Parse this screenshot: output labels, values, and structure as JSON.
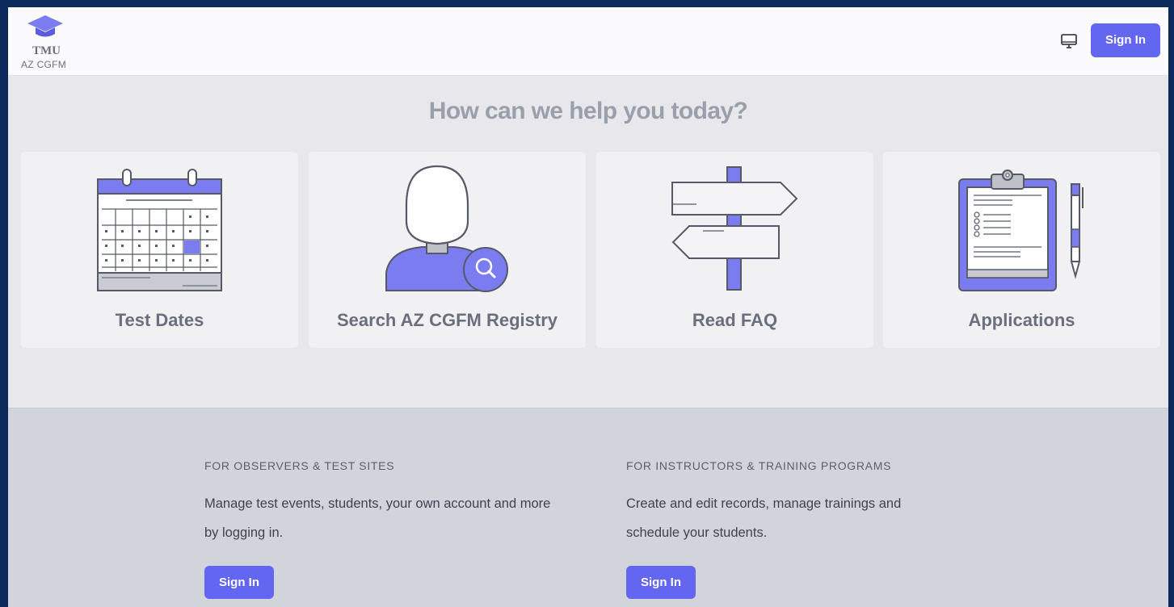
{
  "header": {
    "logo_text": "TMU",
    "org_name": "AZ CGFM",
    "sign_in_label": "Sign In",
    "icons": {
      "logo": "graduation-cap-icon",
      "display": "monitor-icon"
    }
  },
  "hero": {
    "title": "How can we help you today?",
    "cards": [
      {
        "label": "Test Dates",
        "icon": "calendar-icon"
      },
      {
        "label": "Search AZ CGFM Registry",
        "icon": "person-search-icon"
      },
      {
        "label": "Read FAQ",
        "icon": "signpost-icon"
      },
      {
        "label": "Applications",
        "icon": "clipboard-icon"
      }
    ]
  },
  "sections": [
    {
      "heading": "FOR OBSERVERS & TEST SITES",
      "text": "Manage test events, students, your own account and more by logging in.",
      "button_label": "Sign In"
    },
    {
      "heading": "FOR INSTRUCTORS & TRAINING PROGRAMS",
      "text": "Create and edit records, manage trainings and schedule your students.",
      "button_label": "Sign In"
    }
  ],
  "colors": {
    "accent": "#6366f1",
    "illustration_accent": "#7b7cf0",
    "outline": "#555a66",
    "frame_border": "#0b2a5b"
  }
}
